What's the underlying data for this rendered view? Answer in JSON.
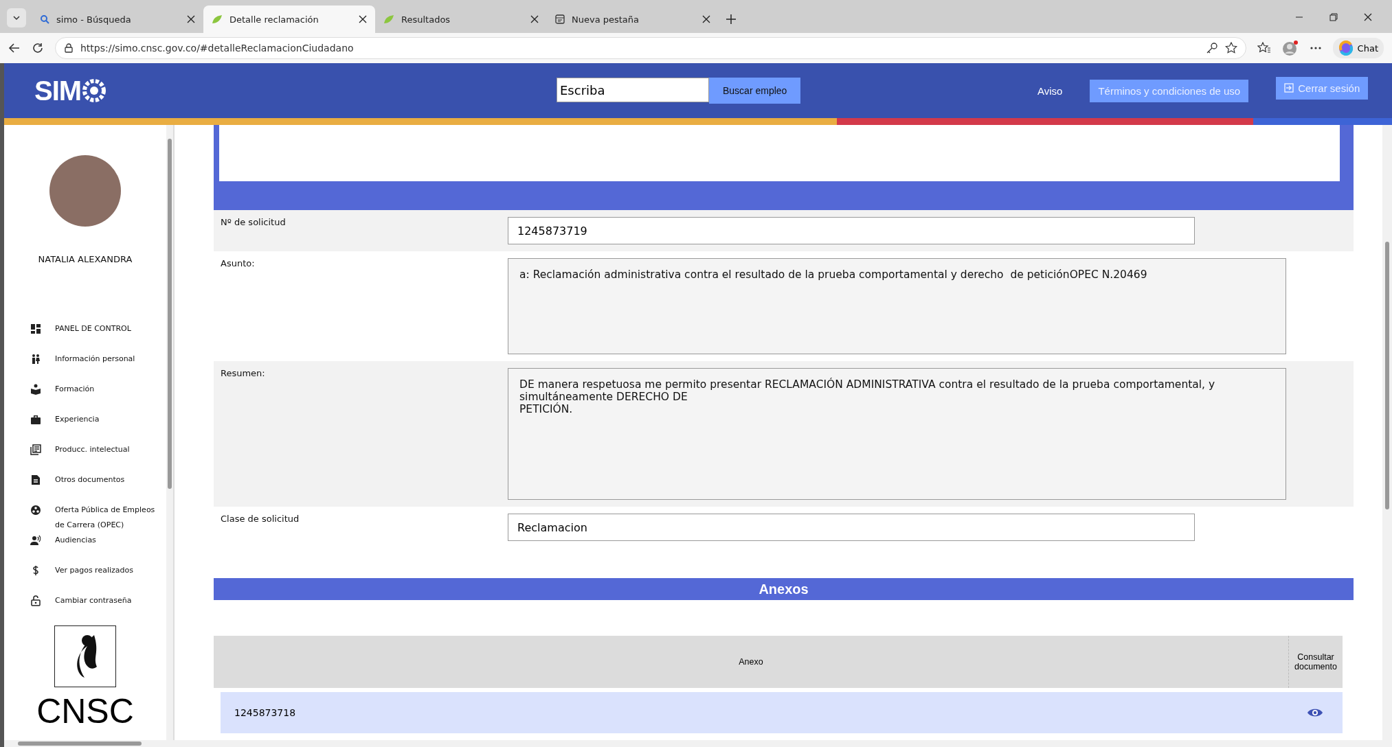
{
  "browser": {
    "tabs": [
      {
        "title": "simo - Búsqueda",
        "kind": "search",
        "selected": false
      },
      {
        "title": "Detalle reclamación",
        "kind": "leaf",
        "selected": true
      },
      {
        "title": "Resultados",
        "kind": "leaf",
        "selected": false
      },
      {
        "title": "Nueva pestaña",
        "kind": "page",
        "selected": false
      }
    ],
    "url": "https://simo.cnsc.gov.co/#detalleReclamacionCiudadano",
    "chat": "Chat"
  },
  "header": {
    "logo": "SIM",
    "search_value": "Escriba",
    "search_button": "Buscar empleo",
    "links": [
      {
        "label": "Aviso",
        "kind": "text"
      },
      {
        "label": "Términos y condiciones de uso",
        "kind": "button"
      },
      {
        "label": "Cerrar sesión",
        "kind": "logout"
      }
    ]
  },
  "sidebar": {
    "user_name": "NATALIA ALEXANDRA",
    "items": [
      {
        "label": "PANEL DE CONTROL",
        "kind": "dashboard"
      },
      {
        "label": "Información personal",
        "kind": "people"
      },
      {
        "label": "Formación",
        "kind": "book"
      },
      {
        "label": "Experiencia",
        "kind": "briefcase"
      },
      {
        "label": "Producc. intelectual",
        "kind": "library"
      },
      {
        "label": "Otros documentos",
        "kind": "document"
      },
      {
        "label": "Oferta Pública de Empleos de Carrera (OPEC)",
        "kind": "circle"
      },
      {
        "label": "Audiencias",
        "kind": "speaker"
      },
      {
        "label": "Ver pagos realizados",
        "kind": "dollar"
      },
      {
        "label": "Cambiar contraseña",
        "kind": "lock"
      }
    ],
    "org_logo": "CNSC"
  },
  "form": {
    "fields": [
      {
        "label": "Nº de solicitud",
        "value": "1245873719",
        "kind": "input"
      },
      {
        "label": "Asunto:",
        "value": "a: Reclamación administrativa contra el resultado de la prueba comportamental y derecho  de peticiónOPEC N.20469",
        "kind": "textarea"
      },
      {
        "label": "Resumen:",
        "value": "DE manera respetuosa me permito presentar RECLAMACIÓN ADMINISTRATIVA contra el resultado de la prueba comportamental, y simultáneamente DERECHO DE\nPETICIÓN.",
        "kind": "textarea"
      },
      {
        "label": "Clase de solicitud",
        "value": "Reclamacion",
        "kind": "input"
      }
    ]
  },
  "anexos": {
    "title": "Anexos",
    "columns": [
      "Anexo",
      "Consultar documento"
    ],
    "rows": [
      {
        "anexo": "1245873718"
      }
    ]
  }
}
